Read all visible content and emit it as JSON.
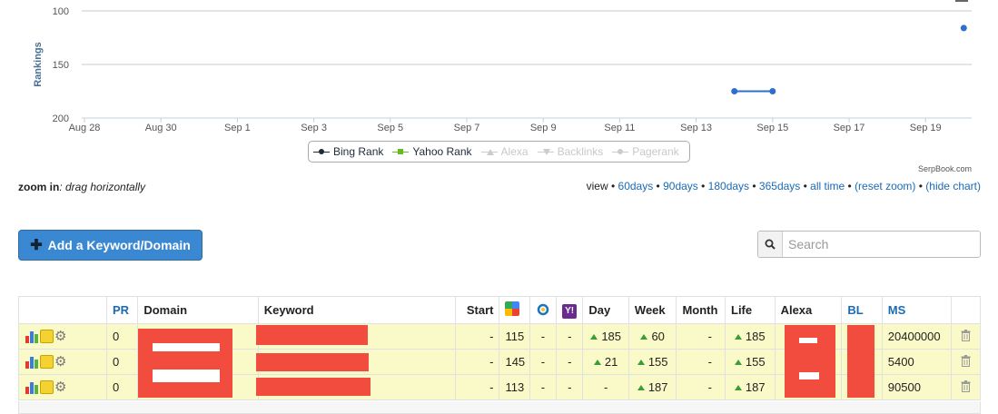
{
  "chart_data": {
    "type": "line",
    "ylabel": "Rankings",
    "yticks": [
      "100",
      "150",
      "200"
    ],
    "ylim": [
      100,
      200
    ],
    "y_reversed": true,
    "xticks": [
      "Aug 28",
      "Aug 30",
      "Sep 1",
      "Sep 3",
      "Sep 5",
      "Sep 7",
      "Sep 9",
      "Sep 11",
      "Sep 13",
      "Sep 15",
      "Sep 17",
      "Sep 19"
    ],
    "series": [
      {
        "name": "Bing Rank",
        "color": "#2f6fcc",
        "points": [
          {
            "x": "Sep 14",
            "y": 175
          },
          {
            "x": "Sep 15",
            "y": 175
          }
        ]
      },
      {
        "name": "Yahoo Rank",
        "color": "#66bb22",
        "points": []
      }
    ],
    "extra_points": [
      {
        "x": "Sep 20",
        "y": 116,
        "color": "#2f6fcc"
      }
    ],
    "grid": true,
    "legend_position": "bottom-center"
  },
  "legend": [
    {
      "label": "Bing Rank",
      "color": "#1e2a3a",
      "active": true,
      "marker": "circle"
    },
    {
      "label": "Yahoo Rank",
      "color": "#66bb22",
      "active": true,
      "marker": "square"
    },
    {
      "label": "Alexa",
      "color": "#cccccc",
      "active": false,
      "marker": "triangle"
    },
    {
      "label": "Backlinks",
      "color": "#cccccc",
      "active": false,
      "marker": "triangle-down"
    },
    {
      "label": "Pagerank",
      "color": "#cccccc",
      "active": false,
      "marker": "circle"
    }
  ],
  "credit": "SerpBook.com",
  "zoom": {
    "bold": "zoom in",
    "rest": ": drag horizontally"
  },
  "view": {
    "prefix": "view • ",
    "links": [
      "60days",
      "90days",
      "180days",
      "365days",
      "all time",
      "(reset zoom)",
      "(hide chart)"
    ]
  },
  "add_button": {
    "label": "Add a Keyword/Domain",
    "icon": "plus-icon"
  },
  "search": {
    "placeholder": "Search",
    "icon": "search-icon"
  },
  "table": {
    "headers": {
      "pr": "PR",
      "domain": "Domain",
      "keyword": "Keyword",
      "start": "Start",
      "day": "Day",
      "week": "Week",
      "month": "Month",
      "life": "Life",
      "alexa": "Alexa",
      "bl": "BL",
      "ms": "MS"
    },
    "engine_icons": [
      "google-icon",
      "bing-icon",
      "yahoo-icon"
    ],
    "rows": [
      {
        "pr": "0",
        "start": "-",
        "google": "115",
        "bing": "-",
        "yahoo": "-",
        "day": "185",
        "week": "60",
        "month": "-",
        "life": "185",
        "ms": "20400000"
      },
      {
        "pr": "0",
        "start": "-",
        "google": "145",
        "bing": "-",
        "yahoo": "-",
        "day": "21",
        "week": "155",
        "month": "-",
        "life": "155",
        "ms": "5400"
      },
      {
        "pr": "0",
        "start": "-",
        "google": "113",
        "bing": "-",
        "yahoo": "-",
        "day": "-",
        "week": "187",
        "month": "-",
        "life": "187",
        "ms": "90500"
      }
    ],
    "day_up": [
      true,
      true,
      false
    ],
    "week_up": [
      true,
      true,
      true
    ],
    "life_up": [
      true,
      true,
      true
    ]
  }
}
